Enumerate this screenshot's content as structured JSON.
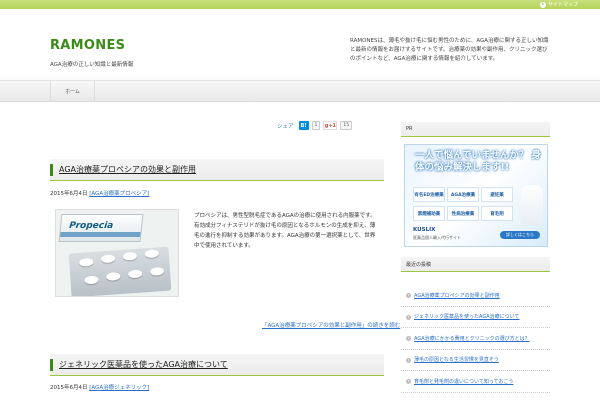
{
  "topbar": {
    "link_label": "サイトマップ"
  },
  "header": {
    "site_title": "RAMONES",
    "site_description": "AGA治療の正しい知識と最新情報",
    "intro_text": "RAMONESは、薄毛や抜け毛に悩む男性のために、AGA治療に関する正しい知識と最新の情報をお届けするサイトです。治療薬の効果や副作用、クリニック選びのポイントなど、AGA治療に関する情報を紹介しています。"
  },
  "nav": {
    "items": [
      {
        "label": "ホーム"
      }
    ]
  },
  "share": {
    "label": "シェア",
    "hatena": {
      "icon": "B!",
      "count": "1"
    },
    "gplus": {
      "icon": "g+1",
      "count": "15"
    }
  },
  "posts": [
    {
      "title": "AGA治療薬プロペシアの効果と副作用",
      "date": "2015年6月4日",
      "category": "[AGA治療薬プロペシア]",
      "image": {
        "box_label": "Propecia"
      },
      "excerpt": "プロペシアは、男性型脱毛症であるAGAの治療に使用される内服薬です。有効成分フィナステリドが抜け毛の原因となるホルモンの生成を抑え、薄毛の進行を抑制する効果があります。AGA治療の第一選択薬として、世界中で使用されています。",
      "read_more": "「AGA治療薬プロペシアの効果と副作用」の続きを読む"
    },
    {
      "title": "ジェネリック医薬品を使ったAGA治療について",
      "date": "2015年6月4日",
      "category": "[AGA治療ジェネリック]"
    }
  ],
  "sidebar": {
    "pr_heading": "PR",
    "ad": {
      "headline": "一人で悩んでいませんか？ 身体の悩み解決します!!",
      "cells": [
        "有名ED治療薬",
        "AGA治療薬",
        "避妊薬",
        "禁煙補助薬",
        "性病治療薬",
        "育毛剤"
      ],
      "logo": "KUSLIX",
      "sub": "医薬品個人輸入代行サイト",
      "button": "詳しくはこちら"
    },
    "recent_heading": "最近の投稿",
    "recent_posts": [
      "AGA治療薬プロペシアの効果と副作用",
      "ジェネリック医薬品を使ったAGA治療について",
      "AGA治療にかかる費用とクリニックの選び方とは？",
      "薄毛の原因となる生活習慣を見直そう",
      "育毛剤と発毛剤の違いについて知っておこう"
    ]
  },
  "colors": {
    "accent": "#3c8a17",
    "topbar": "#b4d35a",
    "link": "#2a6fc9"
  }
}
